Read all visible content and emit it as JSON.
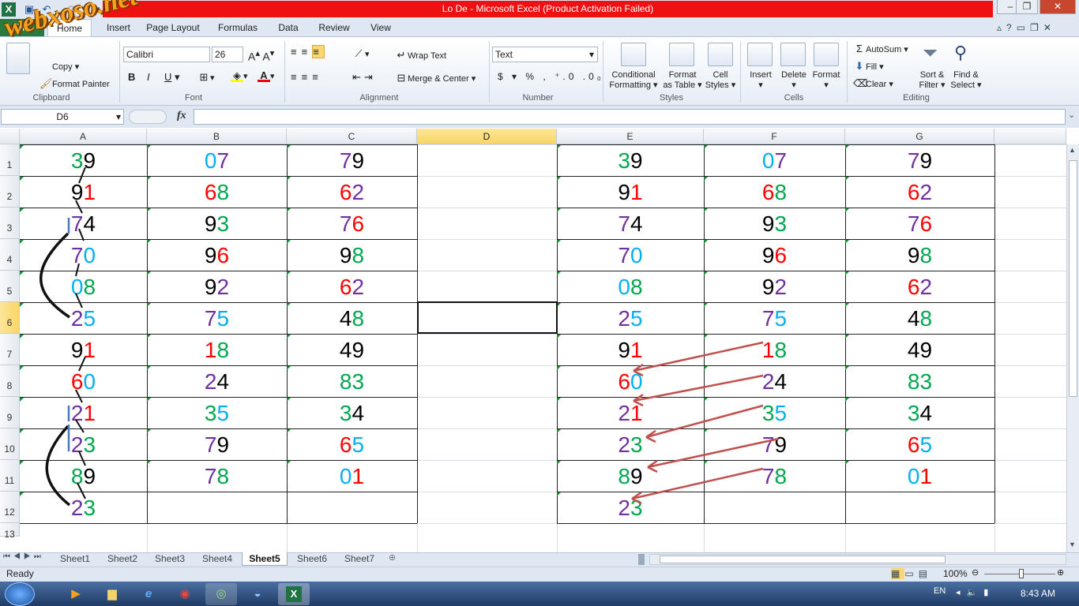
{
  "window": {
    "title": "Lo De  -  Microsoft Excel (Product Activation Failed)"
  },
  "watermark": "webxoso.net",
  "qat": {
    "icons": [
      "excel-icon",
      "save-icon",
      "undo-icon",
      "redo-icon",
      "customize-icon"
    ]
  },
  "tabs": [
    "File",
    "Home",
    "Insert",
    "Page Layout",
    "Formulas",
    "Data",
    "Review",
    "View"
  ],
  "ribbon": {
    "clipboard": {
      "copy": "Copy",
      "format_painter": "Format Painter",
      "label": "Clipboard"
    },
    "font": {
      "name": "Calibri",
      "size": "26",
      "label": "Font"
    },
    "alignment": {
      "wrap": "Wrap Text",
      "merge": "Merge & Center",
      "label": "Alignment"
    },
    "number": {
      "format": "Text",
      "label": "Number"
    },
    "styles": {
      "cond": "Conditional",
      "cond2": "Formatting",
      "fmt_table": "Format",
      "fmt_table2": "as Table",
      "cell_styles": "Cell",
      "cell_styles2": "Styles",
      "label": "Styles"
    },
    "cells": {
      "insert": "Insert",
      "delete": "Delete",
      "format": "Format",
      "label": "Cells"
    },
    "editing": {
      "autosum": "AutoSum",
      "fill": "Fill",
      "clear": "Clear",
      "sort": "Sort &",
      "sort2": "Filter",
      "find": "Find &",
      "find2": "Select",
      "label": "Editing"
    }
  },
  "formula_bar": {
    "name_box": "D6",
    "fx": "fx",
    "value": ""
  },
  "columns": [
    "A",
    "B",
    "C",
    "D",
    "E",
    "F",
    "G"
  ],
  "rows": [
    "1",
    "2",
    "3",
    "4",
    "5",
    "6",
    "7",
    "8",
    "9",
    "10",
    "11",
    "12",
    "13"
  ],
  "colors": {
    "green": "#00a650",
    "purple": "#7030a0",
    "red": "#ff0000",
    "blue": "#00b0f0",
    "black": "#000000",
    "arrow": "#c0504d"
  },
  "cells": {
    "A": [
      "39",
      "91",
      "74",
      "70",
      "08",
      "25",
      "91",
      "60",
      "21",
      "23",
      "89",
      "23"
    ],
    "B": [
      "07",
      "68",
      "93",
      "96",
      "92",
      "75",
      "18",
      "24",
      "35",
      "79",
      "78",
      ""
    ],
    "C": [
      "79",
      "62",
      "76",
      "98",
      "62",
      "48",
      "49",
      "83",
      "34",
      "65",
      "01",
      ""
    ],
    "E": [
      "39",
      "91",
      "74",
      "70",
      "08",
      "25",
      "91",
      "60",
      "21",
      "23",
      "89",
      "23"
    ],
    "F": [
      "07",
      "68",
      "93",
      "96",
      "92",
      "75",
      "18",
      "24",
      "35",
      "79",
      "78",
      ""
    ],
    "G": [
      "79",
      "62",
      "76",
      "98",
      "62",
      "48",
      "49",
      "83",
      "34",
      "65",
      "01",
      ""
    ]
  },
  "digit_colors": {
    "A": [
      [
        "green",
        "black"
      ],
      [
        "black",
        "red"
      ],
      [
        "purple",
        "black"
      ],
      [
        "purple",
        "blue"
      ],
      [
        "blue",
        "green"
      ],
      [
        "purple",
        "blue"
      ],
      [
        "black",
        "red"
      ],
      [
        "red",
        "blue"
      ],
      [
        "purple",
        "red"
      ],
      [
        "purple",
        "green"
      ],
      [
        "green",
        "black"
      ],
      [
        "purple",
        "green"
      ]
    ],
    "B": [
      [
        "blue",
        "purple"
      ],
      [
        "red",
        "green"
      ],
      [
        "black",
        "green"
      ],
      [
        "black",
        "red"
      ],
      [
        "black",
        "purple"
      ],
      [
        "purple",
        "blue"
      ],
      [
        "red",
        "green"
      ],
      [
        "purple",
        "black"
      ],
      [
        "green",
        "blue"
      ],
      [
        "purple",
        "black"
      ],
      [
        "purple",
        "green"
      ],
      []
    ],
    "C": [
      [
        "purple",
        "black"
      ],
      [
        "red",
        "purple"
      ],
      [
        "purple",
        "red"
      ],
      [
        "black",
        "green"
      ],
      [
        "red",
        "purple"
      ],
      [
        "black",
        "green"
      ],
      [
        "black",
        "black"
      ],
      [
        "green",
        "green"
      ],
      [
        "green",
        "black"
      ],
      [
        "red",
        "blue"
      ],
      [
        "blue",
        "red"
      ],
      []
    ]
  },
  "sheets": [
    "Sheet1",
    "Sheet2",
    "Sheet3",
    "Sheet4",
    "Sheet5",
    "Sheet6",
    "Sheet7"
  ],
  "active_sheet": "Sheet5",
  "status": {
    "text": "Ready",
    "zoom": "100%"
  },
  "taskbar": {
    "lang": "EN",
    "time": "8:43 AM",
    "items": [
      "start-orb-icon",
      "media-player-icon",
      "explorer-icon",
      "ie-icon",
      "chrome-icon",
      "app-icon",
      "browser-icon",
      "excel-taskbar-icon"
    ]
  }
}
